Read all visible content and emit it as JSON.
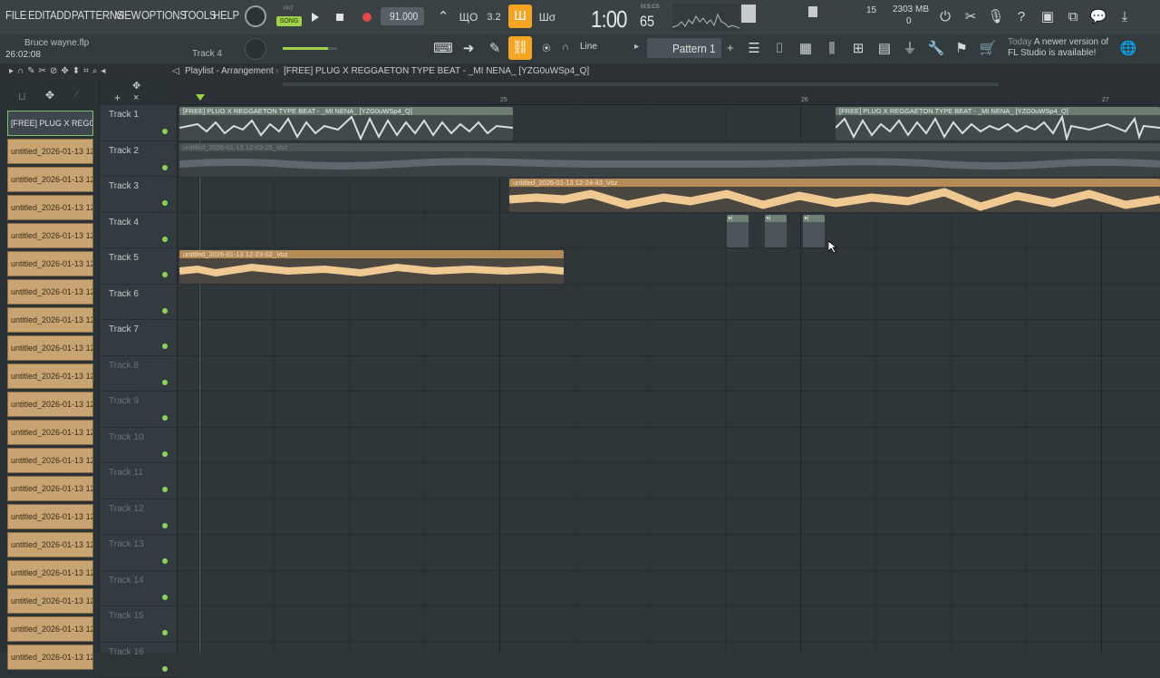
{
  "menu": [
    "FILE",
    "EDIT",
    "ADD",
    "PATTERNS",
    "VIEW",
    "OPTIONS",
    "TOOLS",
    "HELP"
  ],
  "transport": {
    "pat_label": "PAT",
    "song_label": "SONG",
    "tempo": "91.000",
    "time_display": "1:00",
    "time_frames": "65",
    "time_unit": "M:S:CS",
    "cpu_value": "15",
    "memory": "2303 MB",
    "memory_sub": "0"
  },
  "project": {
    "filename": "Bruce wayne.flp",
    "elapsed": "26:02:08",
    "focused_track": "Track 4"
  },
  "toolbar2": {
    "snap": "Line",
    "pattern": "Pattern 1"
  },
  "news": {
    "today": "Today",
    "message": "A newer version of FL Studio is available!"
  },
  "breadcrumb": {
    "section": "Playlist - Arrangement",
    "sep": "›",
    "clip": "[FREE] PLUG X REGGAETON TYPE BEAT - _MI NENA_ [YZG0uWSp4_Q]"
  },
  "browser": {
    "items": [
      "[FREE] PLUG X REGGA...",
      "untitled_2026-01-13 12-...",
      "untitled_2026-01-13 12-...",
      "untitled_2026-01-13 12-...",
      "untitled_2026-01-13 12-...",
      "untitled_2026-01-13 12-...",
      "untitled_2026-01-13 12-...",
      "untitled_2026-01-13 12-...",
      "untitled_2026-01-13 12-...",
      "untitled_2026-01-13 12-...",
      "untitled_2026-01-13 12-...",
      "untitled_2026-01-13 12-...",
      "untitled_2026-01-13 12-...",
      "untitled_2026-01-13 12-...",
      "untitled_2026-01-13 12-...",
      "untitled_2026-01-13 12-...",
      "untitled_2026-01-13 12-...",
      "untitled_2026-01-13 12-...",
      "untitled_2026-01-13 12-...",
      "untitled_2026-01-13 12-..."
    ]
  },
  "ruler": {
    "markers": [
      "25",
      "26",
      "27"
    ]
  },
  "tracks": [
    {
      "name": "Track 1",
      "dim": false
    },
    {
      "name": "Track 2",
      "dim": false
    },
    {
      "name": "Track 3",
      "dim": false
    },
    {
      "name": "Track 4",
      "dim": false
    },
    {
      "name": "Track 5",
      "dim": false
    },
    {
      "name": "Track 6",
      "dim": false
    },
    {
      "name": "Track 7",
      "dim": false
    },
    {
      "name": "Track 8",
      "dim": true
    },
    {
      "name": "Track 9",
      "dim": true
    },
    {
      "name": "Track 10",
      "dim": true
    },
    {
      "name": "Track 11",
      "dim": true
    },
    {
      "name": "Track 12",
      "dim": true
    },
    {
      "name": "Track 13",
      "dim": true
    },
    {
      "name": "Track 14",
      "dim": true
    },
    {
      "name": "Track 15",
      "dim": true
    },
    {
      "name": "Track 16",
      "dim": true
    }
  ],
  "clips": {
    "beat_a": "[FREE] PLUG X REGGAETON TYPE BEAT - _MI NENA_ [YZG0uWSp4_Q]",
    "beat_b": "[FREE] PLUG X REGGAETON TYPE BEAT - _MI NENA_ [YZG0uWSp4_Q]",
    "voz_track2": "untitled_2026-01-13 12-03-25_Voz",
    "voz_track3": "untitled_2026-01-13 12-24-43_Voz",
    "voz_track5": "untitled_2026-01-13 12-23-02_Voz"
  },
  "icons": {
    "play": "play-icon",
    "stop": "stop-icon",
    "record": "record-icon"
  },
  "colors": {
    "accent_orange": "#f5a524",
    "song_green": "#9fd24a",
    "clip_orange": "#b58c58",
    "track_dot": "#8fd25a"
  }
}
